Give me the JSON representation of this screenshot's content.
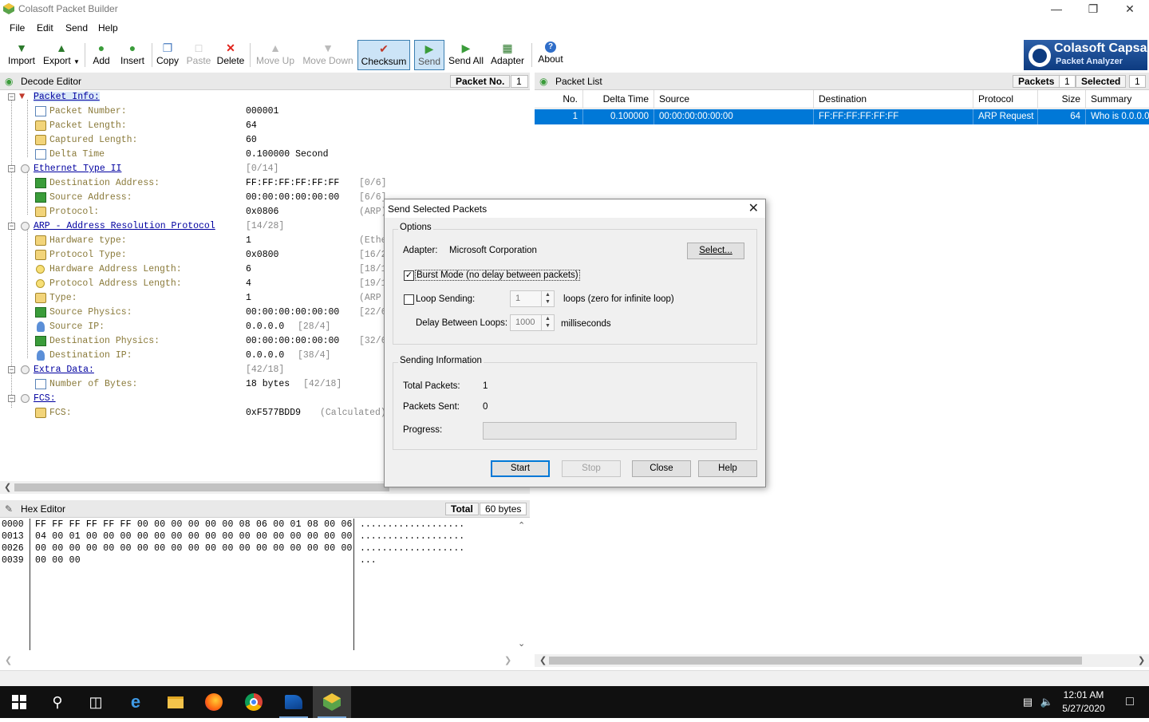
{
  "window": {
    "title": "Colasoft Packet Builder"
  },
  "menu": [
    "File",
    "Edit",
    "Send",
    "Help"
  ],
  "toolbar": {
    "import": "Import",
    "export": "Export",
    "add": "Add",
    "insert": "Insert",
    "copy": "Copy",
    "paste": "Paste",
    "delete": "Delete",
    "move_up": "Move Up",
    "move_down": "Move Down",
    "checksum": "Checksum",
    "send": "Send",
    "send_all": "Send All",
    "adapter": "Adapter",
    "about": "About"
  },
  "logo": {
    "line1": "Colasoft Capsa",
    "line2": "Packet Analyzer"
  },
  "decode_editor": {
    "title": "Decode Editor",
    "packet_no_label": "Packet No.",
    "packet_no_value": "1",
    "rows": [
      {
        "name": "Packet Info:",
        "value": "",
        "offset": ""
      },
      {
        "name": "Packet Number:",
        "value": "000001",
        "offset": ""
      },
      {
        "name": "Packet Length:",
        "value": "64",
        "offset": ""
      },
      {
        "name": "Captured Length:",
        "value": "60",
        "offset": ""
      },
      {
        "name": "Delta Time",
        "value": "0.100000 Second",
        "offset": ""
      },
      {
        "name": "Ethernet Type II",
        "value": "[0/14]",
        "offset": ""
      },
      {
        "name": "Destination Address:",
        "value": "FF:FF:FF:FF:FF:FF",
        "offset": "[0/6]"
      },
      {
        "name": "Source Address:",
        "value": "00:00:00:00:00:00",
        "offset": "[6/6]"
      },
      {
        "name": "Protocol:",
        "value": "0x0806",
        "offset": "(ARP)"
      },
      {
        "name": "ARP - Address Resolution Protocol",
        "value": "[14/28]",
        "offset": ""
      },
      {
        "name": "Hardware type:",
        "value": "1",
        "offset": "(Ethe"
      },
      {
        "name": "Protocol Type:",
        "value": "0x0800",
        "offset": "[16/2"
      },
      {
        "name": "Hardware Address Length:",
        "value": "6",
        "offset": "[18/1"
      },
      {
        "name": "Protocol Address Length:",
        "value": "4",
        "offset": "[19/1"
      },
      {
        "name": "Type:",
        "value": "1",
        "offset": "(ARP"
      },
      {
        "name": "Source Physics:",
        "value": "00:00:00:00:00:00",
        "offset": "[22/6"
      },
      {
        "name": "Source IP:",
        "value": "0.0.0.0",
        "offset": "[28/4]"
      },
      {
        "name": "Destination Physics:",
        "value": "00:00:00:00:00:00",
        "offset": "[32/6"
      },
      {
        "name": "Destination IP:",
        "value": "0.0.0.0",
        "offset": "[38/4]"
      },
      {
        "name": "Extra Data:",
        "value": "[42/18]",
        "offset": ""
      },
      {
        "name": "Number of Bytes:",
        "value": "18 bytes",
        "offset": "[42/18]"
      },
      {
        "name": "FCS:",
        "value": "",
        "offset": ""
      },
      {
        "name": "FCS:",
        "value": "0xF577BDD9",
        "offset": "(Calculated)"
      }
    ]
  },
  "hex_editor": {
    "title": "Hex Editor",
    "total_label": "Total",
    "total_value": "60 bytes",
    "lines": [
      {
        "addr": "0000",
        "bytes": "FF FF FF FF FF FF 00 00 00 00 00 00 08 06 00 01 08 00 06",
        "ascii": "..................."
      },
      {
        "addr": "0013",
        "bytes": "04 00 01 00 00 00 00 00 00 00 00 00 00 00 00 00 00 00 00",
        "ascii": "..................."
      },
      {
        "addr": "0026",
        "bytes": "00 00 00 00 00 00 00 00 00 00 00 00 00 00 00 00 00 00 00",
        "ascii": "..................."
      },
      {
        "addr": "0039",
        "bytes": "00 00 00",
        "ascii": "..."
      }
    ]
  },
  "packet_list": {
    "title": "Packet List",
    "packets_label": "Packets",
    "packets_value": "1",
    "selected_label": "Selected",
    "selected_value": "1",
    "columns": [
      "No.",
      "Delta Time",
      "Source",
      "Destination",
      "Protocol",
      "Size",
      "Summary"
    ],
    "rows": [
      {
        "no": "1",
        "delta": "0.100000",
        "source": "00:00:00:00:00:00",
        "destination": "FF:FF:FF:FF:FF:FF",
        "protocol": "ARP Request",
        "size": "64",
        "summary": "Who is 0.0.0.0"
      }
    ]
  },
  "dialog": {
    "title": "Send Selected Packets",
    "options_label": "Options",
    "adapter_label": "Adapter:",
    "adapter_value": "Microsoft Corporation",
    "select_button": "Select...",
    "burst_mode_label": "Burst Mode (no delay between packets)",
    "burst_mode_checked": true,
    "loop_sending_label": "Loop Sending:",
    "loop_sending_checked": false,
    "loop_count": "1",
    "loops_hint": "loops (zero for infinite loop)",
    "delay_label": "Delay Between Loops:",
    "delay_value": "1000",
    "delay_unit": "milliseconds",
    "sending_info_label": "Sending Information",
    "total_packets_label": "Total Packets:",
    "total_packets_value": "1",
    "packets_sent_label": "Packets Sent:",
    "packets_sent_value": "0",
    "progress_label": "Progress:",
    "progress_fraction": 0,
    "start_button": "Start",
    "stop_button": "Stop",
    "close_button": "Close",
    "help_button": "Help"
  },
  "taskbar": {
    "time": "12:01 AM",
    "date": "5/27/2020",
    "apps": [
      "start-icon",
      "search-icon",
      "task-view-icon",
      "edge-icon",
      "file-explorer-icon",
      "firefox-icon",
      "chrome-icon",
      "wireshark-icon",
      "packet-builder-icon"
    ]
  }
}
